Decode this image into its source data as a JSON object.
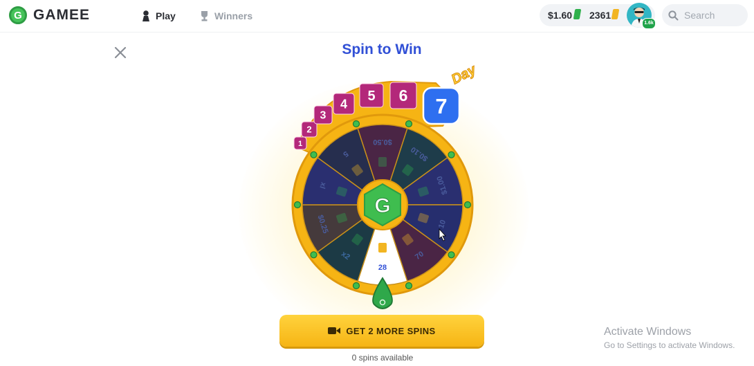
{
  "brand": {
    "logo_letter": "G",
    "name": "GAMEE"
  },
  "nav": {
    "play": "Play",
    "winners": "Winners"
  },
  "wallet": {
    "money": "$1.60",
    "tickets": "2361"
  },
  "user": {
    "level": "1.6k"
  },
  "search": {
    "placeholder": "Search"
  },
  "page": {
    "title": "Spin to Win"
  },
  "streak": {
    "label": "Day",
    "days": [
      "1",
      "2",
      "3",
      "4",
      "5",
      "6",
      "7"
    ],
    "current_day": "7"
  },
  "wheel": {
    "center_letter": "G",
    "segments": [
      {
        "label": "28",
        "type": "tickets",
        "color": "#ffffff",
        "text_color": "#3150d6"
      },
      {
        "label": "x2",
        "type": "cash",
        "color": "#1c3a45",
        "text_color": "#3d6aa0"
      },
      {
        "label": "$0.25",
        "type": "cash",
        "color": "#453a3c",
        "text_color": "#4a5c9c"
      },
      {
        "label": "xl",
        "type": "cash",
        "color": "#2a2f70",
        "text_color": "#4a5c9c"
      },
      {
        "label": "5",
        "type": "tickets",
        "color": "#262e4e",
        "text_color": "#4a5c9c"
      },
      {
        "label": "$0.50",
        "type": "cash",
        "color": "#4a2545",
        "text_color": "#4a5c9c"
      },
      {
        "label": "$0.10",
        "type": "cash",
        "color": "#1e3c4a",
        "text_color": "#4a5c9c"
      },
      {
        "label": "$1.00",
        "type": "cash",
        "color": "#2a2f70",
        "text_color": "#4a5c9c"
      },
      {
        "label": "10",
        "type": "tickets",
        "color": "#262e6e",
        "text_color": "#4a5c9c"
      },
      {
        "label": "70",
        "type": "tickets",
        "color": "#4a2545",
        "text_color": "#4a5c9c"
      }
    ]
  },
  "cta": {
    "label": "GET 2 MORE SPINS"
  },
  "spins_available": "0 spins available",
  "watermark": {
    "title": "Activate Windows",
    "subtitle": "Go to Settings to activate Windows."
  },
  "colors": {
    "accent": "#3150d6",
    "gold": "#f6b414",
    "magenta": "#b3287a",
    "green": "#2fb04c"
  }
}
